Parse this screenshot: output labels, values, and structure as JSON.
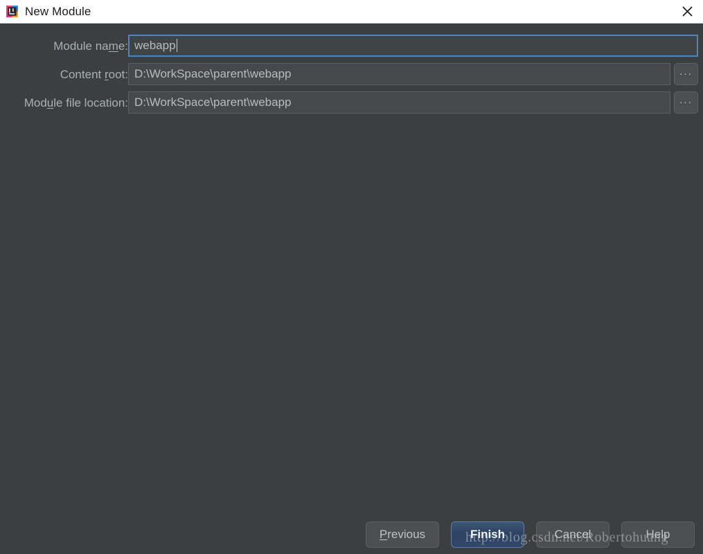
{
  "window": {
    "title": "New Module",
    "app_icon": "intellij-idea-icon",
    "close_icon": "close-icon",
    "titlebar_bg": "#ffffff",
    "body_bg": "#3c3f41"
  },
  "form": {
    "fields": [
      {
        "label_before": "Module na",
        "label_mnemonic": "m",
        "label_after": "e:",
        "value": "webapp",
        "focused": true,
        "has_browse": false,
        "browse_label": "..."
      },
      {
        "label_before": "Content ",
        "label_mnemonic": "r",
        "label_after": "oot:",
        "value": "D:\\WorkSpace\\parent\\webapp",
        "focused": false,
        "has_browse": true,
        "browse_label": "..."
      },
      {
        "label_before": "Mod",
        "label_mnemonic": "u",
        "label_after": "le file location:",
        "value": "D:\\WorkSpace\\parent\\webapp",
        "focused": false,
        "has_browse": true,
        "browse_label": "..."
      }
    ]
  },
  "buttons": {
    "previous": {
      "before": "",
      "mnemonic": "P",
      "after": "revious"
    },
    "finish": {
      "before": "Finish",
      "mnemonic": "",
      "after": ""
    },
    "cancel": {
      "before": "Cancel",
      "mnemonic": "",
      "after": ""
    },
    "help": {
      "before": "Help",
      "mnemonic": "",
      "after": ""
    },
    "default_button": "Finish",
    "accent_color": "#4c87c4"
  },
  "watermark": {
    "text": "http://blog.csdn.net/Robertohuang"
  }
}
